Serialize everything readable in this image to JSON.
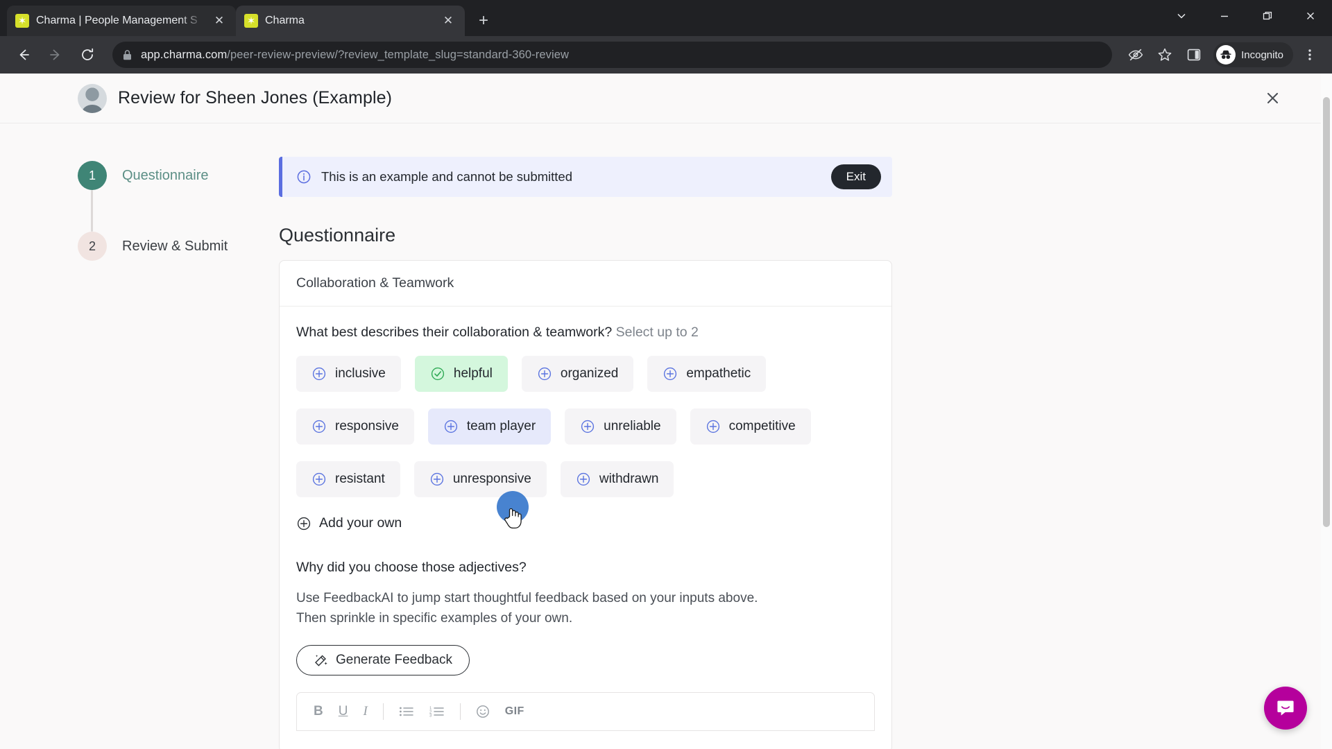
{
  "browser": {
    "tabs": [
      {
        "title": "Charma | People Management S",
        "favicon": "charma-star-icon",
        "active": false
      },
      {
        "title": "Charma",
        "favicon": "charma-star-icon",
        "active": true
      }
    ],
    "new_tab_label": "+",
    "window_controls": [
      "tab-search-chevron",
      "minimize",
      "maximize-restore",
      "close"
    ],
    "nav": {
      "back": "back-arrow-icon",
      "forward": "forward-arrow-icon",
      "reload": "reload-icon"
    },
    "omnibox": {
      "lock": "lock-icon",
      "domain": "app.charma.com",
      "path": "/peer-review-preview/?review_template_slug=standard-360-review",
      "full_url": "app.charma.com/peer-review-preview/?review_template_slug=standard-360-review"
    },
    "toolbar_icons": [
      "third-party-cookie-blocked-icon",
      "bookmark-star-icon",
      "side-panel-icon"
    ],
    "profile": {
      "label": "Incognito",
      "icon": "incognito-icon"
    },
    "menu_icon": "kebab-menu-icon"
  },
  "page": {
    "header": {
      "title": "Review for Sheen Jones (Example)",
      "avatar": "user-avatar",
      "close_icon": "close-icon"
    },
    "stepper": [
      {
        "number": "1",
        "label": "Questionnaire",
        "state": "active"
      },
      {
        "number": "2",
        "label": "Review & Submit",
        "state": "upcoming"
      }
    ],
    "banner": {
      "icon": "info-circle-icon",
      "message": "This is an example and cannot be submitted",
      "action_label": "Exit"
    },
    "section_title": "Questionnaire",
    "card": {
      "heading": "Collaboration & Teamwork",
      "question_1": {
        "text": "What best describes their collaboration & teamwork?",
        "hint": "Select up to 2",
        "chips": [
          {
            "label": "inclusive",
            "state": "default",
            "icon": "plus-circle-icon"
          },
          {
            "label": "helpful",
            "state": "selected",
            "icon": "check-circle-icon"
          },
          {
            "label": "organized",
            "state": "default",
            "icon": "plus-circle-icon"
          },
          {
            "label": "empathetic",
            "state": "default",
            "icon": "plus-circle-icon"
          },
          {
            "label": "responsive",
            "state": "default",
            "icon": "plus-circle-icon"
          },
          {
            "label": "team player",
            "state": "hovered",
            "icon": "plus-circle-icon"
          },
          {
            "label": "unreliable",
            "state": "default",
            "icon": "plus-circle-icon"
          },
          {
            "label": "competitive",
            "state": "default",
            "icon": "plus-circle-icon"
          },
          {
            "label": "resistant",
            "state": "default",
            "icon": "plus-circle-icon"
          },
          {
            "label": "unresponsive",
            "state": "default",
            "icon": "plus-circle-icon"
          },
          {
            "label": "withdrawn",
            "state": "default",
            "icon": "plus-circle-icon"
          }
        ],
        "add_own_label": "Add your own"
      },
      "question_2": {
        "text": "Why did you choose those adjectives?",
        "description_line1": "Use FeedbackAI to jump start thoughtful feedback based on your inputs above.",
        "description_line2": "Then sprinkle in specific examples of your own.",
        "generate_label": "Generate Feedback",
        "generate_icon": "magic-wand-icon"
      },
      "editor_toolbar": [
        {
          "name": "bold",
          "label": "B"
        },
        {
          "name": "underline",
          "label": "U"
        },
        {
          "name": "italic",
          "label": "I"
        },
        {
          "name": "separator",
          "label": ""
        },
        {
          "name": "bulleted-list",
          "label": ""
        },
        {
          "name": "numbered-list",
          "label": ""
        },
        {
          "name": "separator",
          "label": ""
        },
        {
          "name": "emoji",
          "label": ""
        },
        {
          "name": "gif",
          "label": "GIF"
        }
      ]
    },
    "intercom": {
      "icon": "intercom-chat-icon",
      "color": "#b5009c"
    }
  },
  "colors": {
    "accent_teal": "#3f8576",
    "selected_chip_bg": "#d4f7dd",
    "hover_chip_bg": "#e6e9fb",
    "banner_bg": "#eef0fd",
    "banner_border": "#5b6ee0",
    "page_bg": "#faf9f9",
    "favicon": "#d6e02a"
  }
}
